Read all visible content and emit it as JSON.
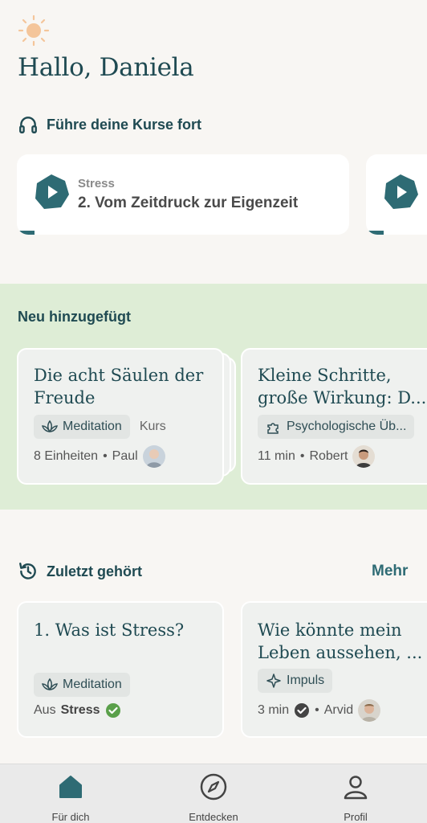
{
  "header": {
    "greeting": "Hallo, Daniela",
    "sun_icon": "sun-icon"
  },
  "continue": {
    "heading": "Führe deine Kurse fort",
    "icon": "headphones-icon",
    "cards": [
      {
        "category": "Stress",
        "title": "2. Vom Zeitdruck zur Eigenzeit"
      }
    ]
  },
  "new_added": {
    "heading": "Neu hinzugefügt",
    "cards": [
      {
        "title": "Die acht Säulen der Freude",
        "tag": "Meditation",
        "tag_icon": "lotus-icon",
        "type": "Kurs",
        "units": "8 Einheiten",
        "author": "Paul"
      },
      {
        "title": "Kleine Schritte, große Wirkung: D...",
        "tag": "Psychologische Üb...",
        "tag_icon": "puzzle-icon",
        "duration": "11 min",
        "author": "Robert"
      }
    ]
  },
  "recent": {
    "heading": "Zuletzt gehört",
    "more": "Mehr",
    "icon": "history-icon",
    "cards": [
      {
        "title": "1. Was ist Stress?",
        "tag": "Meditation",
        "tag_icon": "lotus-icon",
        "from_prefix": "Aus",
        "from_course": "Stress"
      },
      {
        "title": "Wie könnte mein Leben aussehen, ...",
        "tag": "Impuls",
        "tag_icon": "sparkle-icon",
        "duration": "3 min",
        "author": "Arvid"
      }
    ]
  },
  "tabbar": {
    "items": [
      {
        "label": "Für dich",
        "icon": "home-icon"
      },
      {
        "label": "Entdecken",
        "icon": "compass-icon"
      },
      {
        "label": "Profil",
        "icon": "profile-icon"
      }
    ]
  },
  "colors": {
    "primary": "#1f4a52",
    "accent": "#2e6b74",
    "background": "#f8f6f3",
    "new_section_bg": "#deedd6",
    "check_green": "#5aa04a"
  }
}
